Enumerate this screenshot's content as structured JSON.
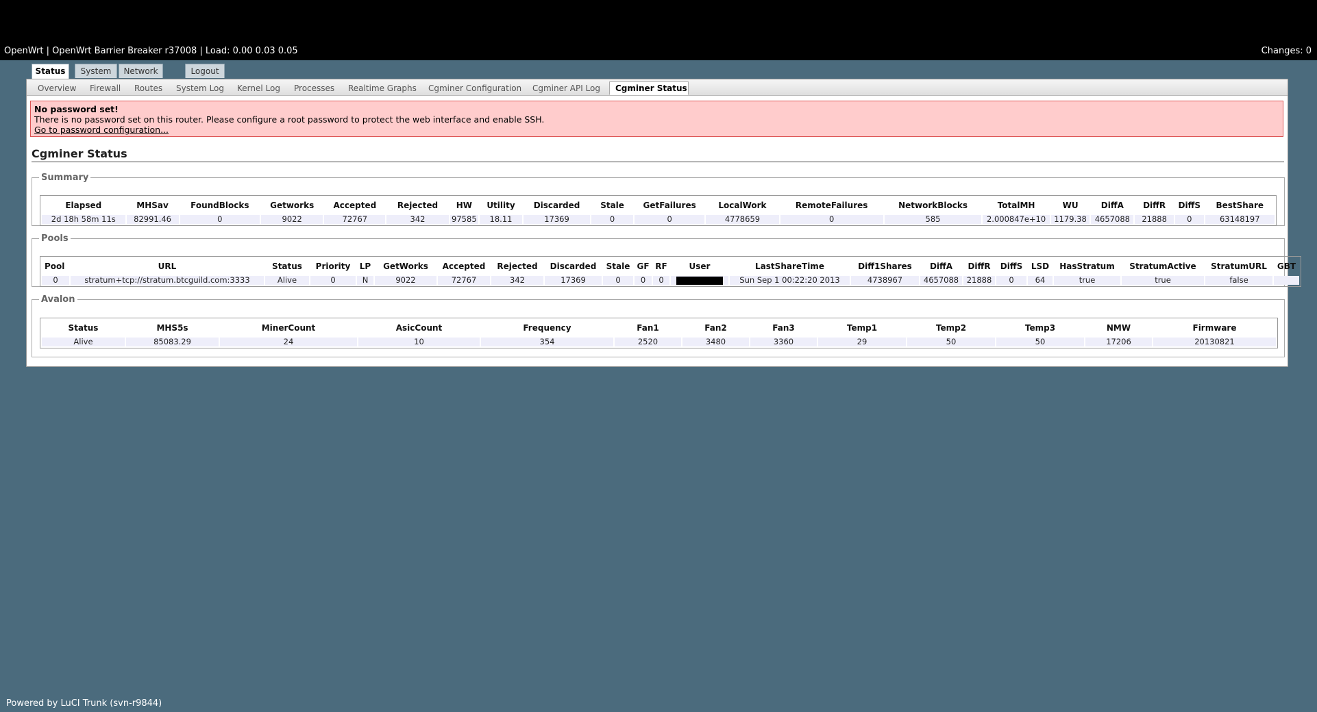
{
  "header": {
    "brand": "OpenWrt | OpenWrt Barrier Breaker r37008 | Load: 0.00 0.03 0.05",
    "changes": "Changes: 0"
  },
  "main_tabs": [
    {
      "label": "Status",
      "active": true
    },
    {
      "label": "System",
      "active": false
    },
    {
      "label": "Network",
      "active": false
    },
    {
      "label": "Logout",
      "active": false
    }
  ],
  "sub_tabs": [
    {
      "label": "Overview"
    },
    {
      "label": "Firewall"
    },
    {
      "label": "Routes"
    },
    {
      "label": "System Log"
    },
    {
      "label": "Kernel Log"
    },
    {
      "label": "Processes"
    },
    {
      "label": "Realtime Graphs"
    },
    {
      "label": "Cgminer Configuration"
    },
    {
      "label": "Cgminer API Log"
    },
    {
      "label": "Cgminer Status",
      "active": true
    }
  ],
  "alert": {
    "title": "No password set!",
    "message": "There is no password set on this router. Please configure a root password to protect the web interface and enable SSH.",
    "link": "Go to password configuration..."
  },
  "page_title": "Cgminer Status",
  "summary": {
    "legend": "Summary",
    "headers": [
      "Elapsed",
      "MHSav",
      "FoundBlocks",
      "Getworks",
      "Accepted",
      "Rejected",
      "HW",
      "Utility",
      "Discarded",
      "Stale",
      "GetFailures",
      "LocalWork",
      "RemoteFailures",
      "NetworkBlocks",
      "TotalMH",
      "WU",
      "DiffA",
      "DiffR",
      "DiffS",
      "BestShare"
    ],
    "row": [
      "2d 18h 58m 11s",
      "82991.46",
      "0",
      "9022",
      "72767",
      "342",
      "97585",
      "18.11",
      "17369",
      "0",
      "0",
      "4778659",
      "0",
      "585",
      "2.000847e+10",
      "1179.38",
      "4657088",
      "21888",
      "0",
      "63148197"
    ]
  },
  "pools": {
    "legend": "Pools",
    "headers": [
      "Pool",
      "URL",
      "Status",
      "Priority",
      "LP",
      "GetWorks",
      "Accepted",
      "Rejected",
      "Discarded",
      "Stale",
      "GF",
      "RF",
      "User",
      "LastShareTime",
      "Diff1Shares",
      "DiffA",
      "DiffR",
      "DiffS",
      "LSD",
      "HasStratum",
      "StratumActive",
      "StratumURL",
      "GBT"
    ],
    "row": [
      "0",
      "stratum+tcp://stratum.btcguild.com:3333",
      "Alive",
      "0",
      "N",
      "9022",
      "72767",
      "342",
      "17369",
      "0",
      "0",
      "0",
      "",
      "Sun Sep 1 00:22:20 2013",
      "4738967",
      "4657088",
      "21888",
      "0",
      "64",
      "true",
      "true",
      "false",
      ""
    ]
  },
  "avalon": {
    "legend": "Avalon",
    "headers": [
      "Status",
      "MHS5s",
      "MinerCount",
      "AsicCount",
      "Frequency",
      "Fan1",
      "Fan2",
      "Fan3",
      "Temp1",
      "Temp2",
      "Temp3",
      "NMW",
      "Firmware"
    ],
    "row": [
      "Alive",
      "85083.29",
      "24",
      "10",
      "354",
      "2520",
      "3480",
      "3360",
      "29",
      "50",
      "50",
      "17206",
      "20130821"
    ]
  },
  "footer": "Powered by LuCI Trunk (svn-r9844)"
}
